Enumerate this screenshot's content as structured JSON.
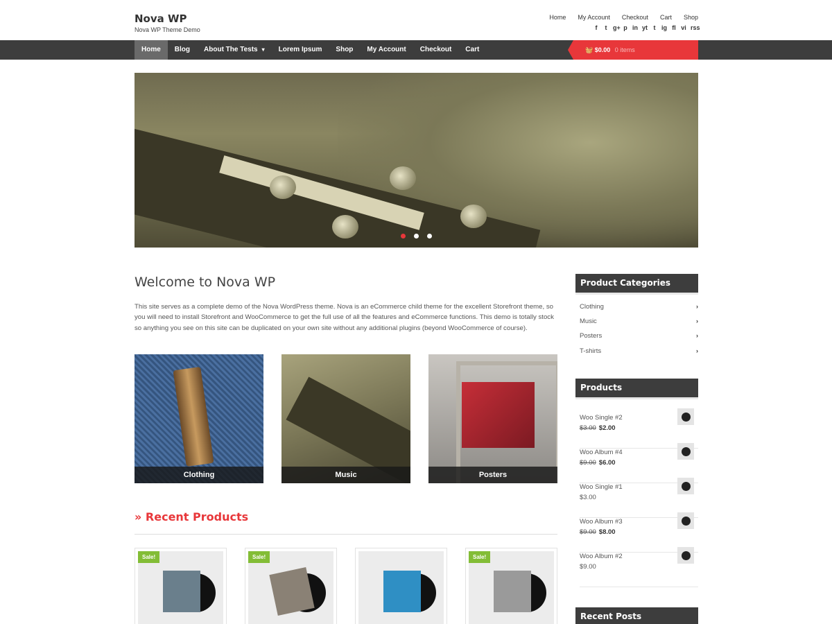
{
  "site": {
    "title": "Nova WP",
    "description": "Nova WP Theme Demo"
  },
  "top_links": [
    "Home",
    "My Account",
    "Checkout",
    "Cart",
    "Shop"
  ],
  "social_icons": [
    "f",
    "t",
    "g+",
    "p",
    "in",
    "yt",
    "t",
    "ig",
    "fl",
    "vi",
    "rss"
  ],
  "nav": {
    "items": [
      {
        "label": "Home",
        "active": true
      },
      {
        "label": "Blog"
      },
      {
        "label": "About The Tests",
        "has_submenu": true
      },
      {
        "label": "Lorem Ipsum"
      },
      {
        "label": "Shop"
      },
      {
        "label": "My Account"
      },
      {
        "label": "Checkout"
      },
      {
        "label": "Cart"
      }
    ],
    "cart": {
      "amount": "$0.00",
      "items": "0 items",
      "accent": "#e8373a"
    }
  },
  "hero": {
    "slides": 3,
    "active_slide": 1
  },
  "welcome": {
    "title": "Welcome to Nova WP",
    "text": "This site serves as a complete demo of the Nova WordPress theme. Nova is an eCommerce child theme for the excellent Storefront theme, so you will need to install Storefront and WooCommerce to get the full use of all the features and eCommerce functions. This demo is totally stock so anything you see on this site can be duplicated on your own site without any additional plugins (beyond WooCommerce of course)."
  },
  "categories_tiles": [
    {
      "label": "Clothing"
    },
    {
      "label": "Music"
    },
    {
      "label": "Posters"
    }
  ],
  "recent_products": {
    "title": "» Recent Products",
    "items": [
      {
        "badge": "Sale!",
        "sleeve_color": "#6a7f8c"
      },
      {
        "badge": "Sale!",
        "sleeve_color": "#8a8175"
      },
      {
        "badge": "",
        "sleeve_color": "#2f8fc4"
      },
      {
        "badge": "Sale!",
        "sleeve_color": "#9a9a9a"
      }
    ]
  },
  "sidebar": {
    "product_categories": {
      "title": "Product Categories",
      "items": [
        "Clothing",
        "Music",
        "Posters",
        "T-shirts"
      ]
    },
    "products": {
      "title": "Products",
      "items": [
        {
          "name": "Woo Single #2",
          "old_price": "$3.00",
          "price": "$2.00"
        },
        {
          "name": "Woo Album #4",
          "old_price": "$9.00",
          "price": "$6.00"
        },
        {
          "name": "Woo Single #1",
          "old_price": "",
          "price": "$3.00"
        },
        {
          "name": "Woo Album #3",
          "old_price": "$9.00",
          "price": "$8.00"
        },
        {
          "name": "Woo Album #2",
          "old_price": "",
          "price": "$9.00"
        }
      ]
    },
    "recent_posts": {
      "title": "Recent Posts"
    }
  }
}
